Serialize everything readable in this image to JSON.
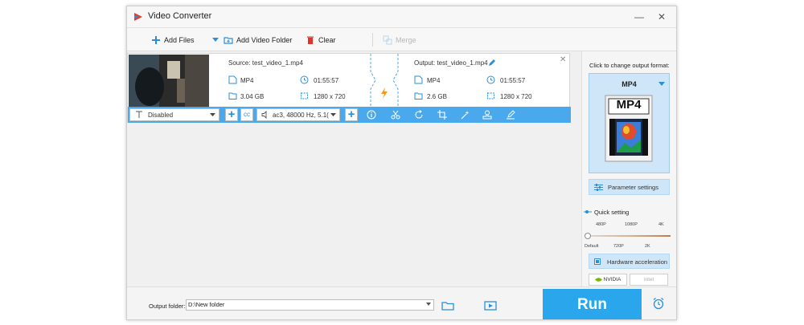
{
  "app": {
    "title": "Video Converter",
    "window_controls": {
      "minimize": "—",
      "close": "✕"
    },
    "accent_color": "#2aa7ec",
    "logo_colors": [
      "#e63b2e",
      "#2a8fd8"
    ]
  },
  "toolbar": {
    "add_files": "Add Files",
    "add_video_folder": "Add Video Folder",
    "clear": "Clear",
    "merge": "Merge"
  },
  "file_item": {
    "source_label": "Source: test_video_1.mp4",
    "output_label": "Output: test_video_1.mp4",
    "source": {
      "format": "MP4",
      "duration": "01:55:57",
      "size": "3.04 GB",
      "resolution": "1280 x 720"
    },
    "output": {
      "format": "MP4",
      "duration": "01:55:57",
      "size": "2.6 GB",
      "resolution": "1280 x 720"
    },
    "close": "✕",
    "subtitle_select": "Disabled",
    "audio_select": "ac3, 48000 Hz, 5.1(",
    "edit_tools": [
      "info-icon",
      "cut-icon",
      "rotate-icon",
      "crop-icon",
      "effects-icon",
      "watermark-icon",
      "edit-subtitle-icon"
    ]
  },
  "right_panel": {
    "title": "Click to change output format:",
    "format": "MP4",
    "format_badge": "MP4",
    "parameter_settings": "Parameter settings",
    "quick_setting": "Quick setting",
    "ticks_top": [
      "480P",
      "1080P",
      "4K"
    ],
    "ticks_bottom": [
      "Default",
      "720P",
      "2K"
    ],
    "hardware_acceleration": "Hardware acceleration",
    "nvidia": "NVIDIA",
    "intel": "Intel"
  },
  "bottom": {
    "output_folder_label": "Output folder:",
    "output_folder_value": "D:\\New folder",
    "run": "Run"
  }
}
